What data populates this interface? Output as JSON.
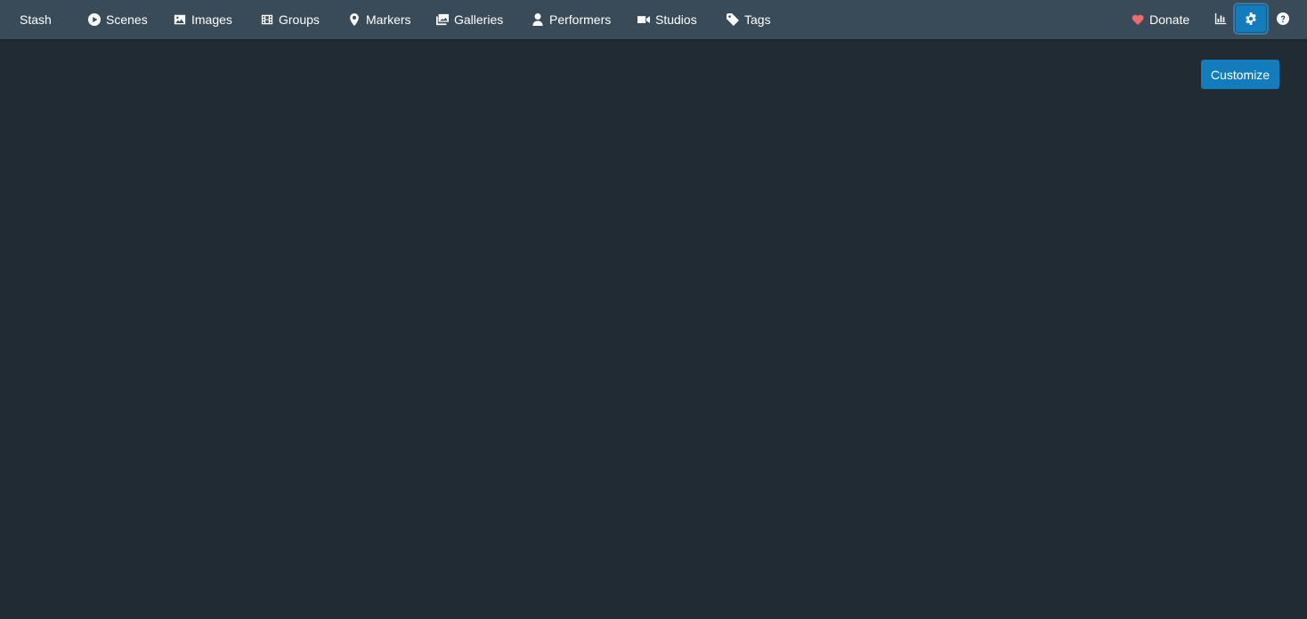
{
  "nav": {
    "brand": "Stash",
    "items": [
      {
        "label": "Scenes",
        "icon": "play-circle-icon"
      },
      {
        "label": "Images",
        "icon": "image-icon"
      },
      {
        "label": "Groups",
        "icon": "film-icon"
      },
      {
        "label": "Markers",
        "icon": "map-marker-icon"
      },
      {
        "label": "Galleries",
        "icon": "images-icon"
      },
      {
        "label": "Performers",
        "icon": "user-icon"
      },
      {
        "label": "Studios",
        "icon": "video-icon"
      },
      {
        "label": "Tags",
        "icon": "tag-icon"
      }
    ],
    "donate": "Donate",
    "stats_icon": "chart-bar-icon",
    "settings_icon": "gear-icon",
    "help_icon": "question-circle-icon"
  },
  "main": {
    "customize_label": "Customize"
  },
  "colors": {
    "background": "#202b33",
    "navbar": "#394b59",
    "accent": "#137cbd",
    "donate_heart": "#ef6a6a"
  }
}
